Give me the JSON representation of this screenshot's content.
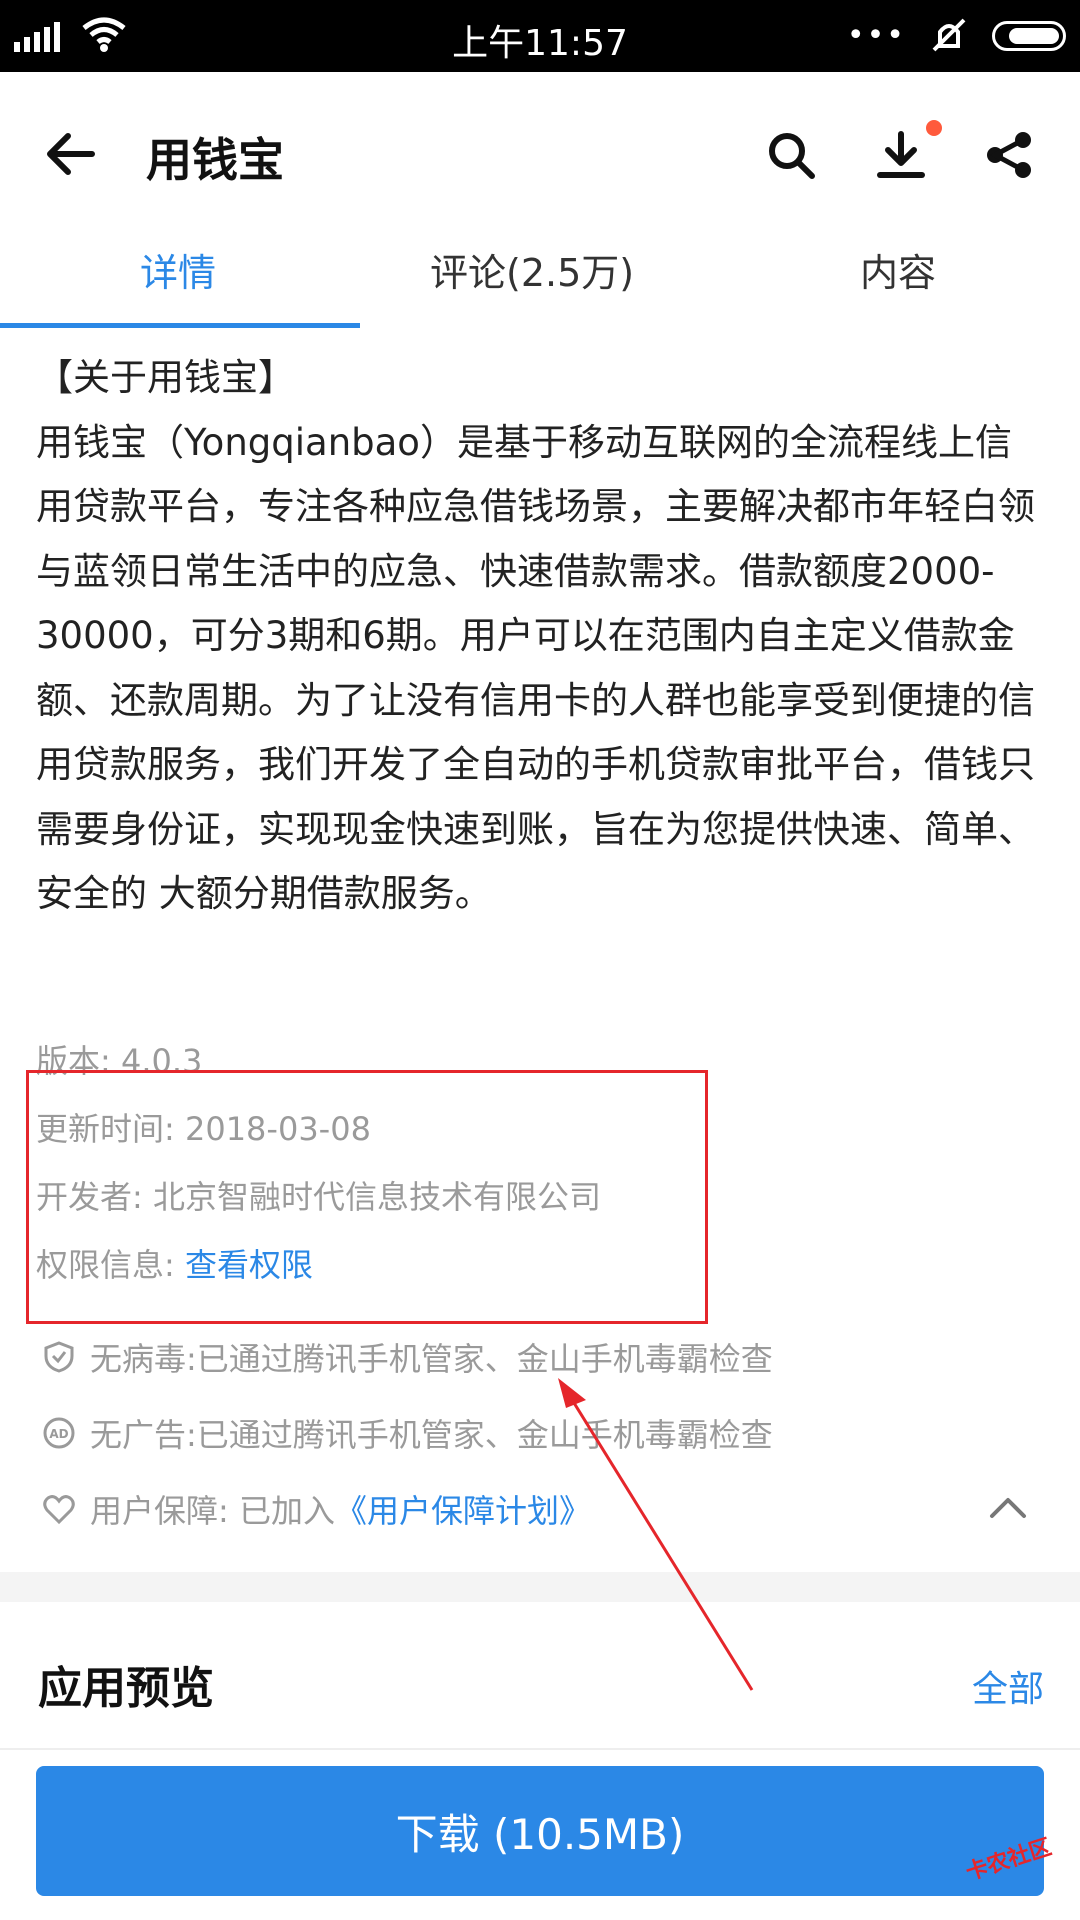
{
  "status_bar": {
    "time": "上午11:57",
    "dots": "•••"
  },
  "header": {
    "title": "用钱宝"
  },
  "tabs": [
    {
      "label": "详情"
    },
    {
      "label": "评论(2.5万)"
    },
    {
      "label": "内容"
    }
  ],
  "about": {
    "heading": "【关于用钱宝】",
    "body": "用钱宝（Yongqianbao）是基于移动互联网的全流程线上信用贷款平台，专注各种应急借钱场景，主要解决都市年轻白领与蓝领日常生活中的应急、快速借款需求。借款额度2000-30000，可分3期和6期。用户可以在范围内自主定义借款金额、还款周期。为了让没有信用卡的人群也能享受到便捷的信用贷款服务，我们开发了全自动的手机贷款审批平台，借钱只需要身份证，实现现金快速到账，旨在为您提供快速、简单、安全的 大额分期借款服务。"
  },
  "meta": {
    "version": "版本: 4.0.3",
    "update_label": "更新时间: ",
    "update_value": "2018-03-08",
    "developer_label": "开发者: ",
    "developer_value": "北京智融时代信息技术有限公司",
    "permission_label": "权限信息: ",
    "permission_link": "查看权限"
  },
  "features": {
    "virus_label": "无病毒: ",
    "virus_value": "已通过腾讯手机管家、金山手机毒霸检查",
    "ads_label": "无广告: ",
    "ads_value": "已通过腾讯手机管家、金山手机毒霸检查",
    "guarantee_label": "用户保障: 已加入",
    "guarantee_link": "《用户保障计划》"
  },
  "preview": {
    "title": "应用预览",
    "all": "全部"
  },
  "download": {
    "label": "下载 (10.5MB)"
  },
  "watermark": "卡农社区",
  "colors": {
    "accent": "#2b88e6",
    "annotation": "#e5262b",
    "badge": "#ff5a3c"
  }
}
